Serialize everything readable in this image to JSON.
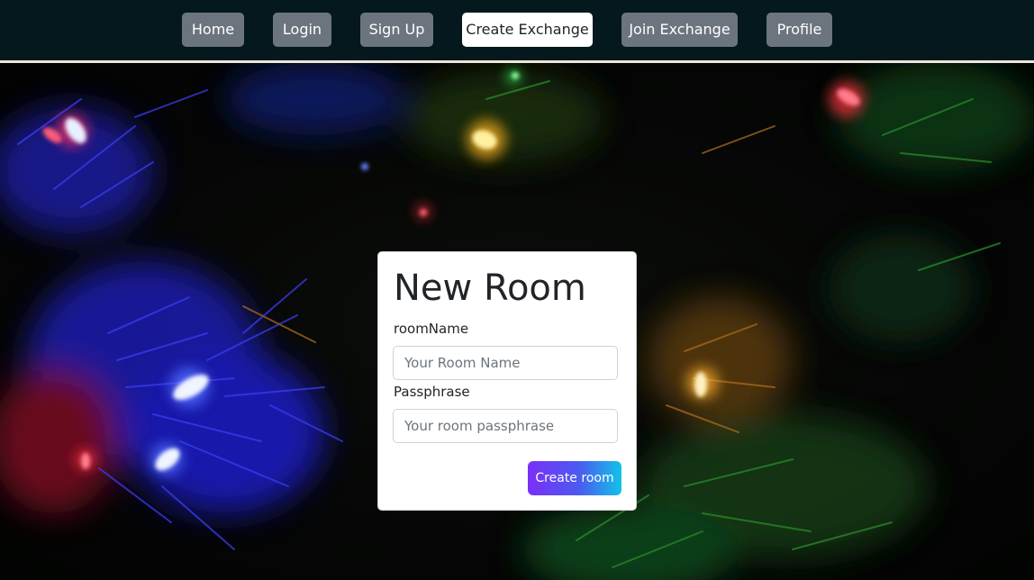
{
  "nav": {
    "items": [
      {
        "label": "Home",
        "active": false
      },
      {
        "label": "Login",
        "active": false
      },
      {
        "label": "Sign Up",
        "active": false
      },
      {
        "label": "Create Exchange",
        "active": true
      },
      {
        "label": "Join Exchange",
        "active": false
      },
      {
        "label": "Profile",
        "active": false
      }
    ]
  },
  "background": {
    "description_icon": "christmas-lights-photo"
  },
  "form": {
    "title": "New Room",
    "room_name": {
      "label": "roomName",
      "placeholder": "Your Room Name",
      "value": ""
    },
    "passphrase": {
      "label": "Passphrase",
      "placeholder": "Your room passphrase",
      "value": ""
    },
    "submit_label": "Create room"
  },
  "colors": {
    "navbar_bg": "#04181e",
    "nav_button": "#6c757d",
    "nav_button_active": "#ffffff",
    "submit_gradient_start": "#7b2ff7",
    "submit_gradient_end": "#12c2e9"
  }
}
